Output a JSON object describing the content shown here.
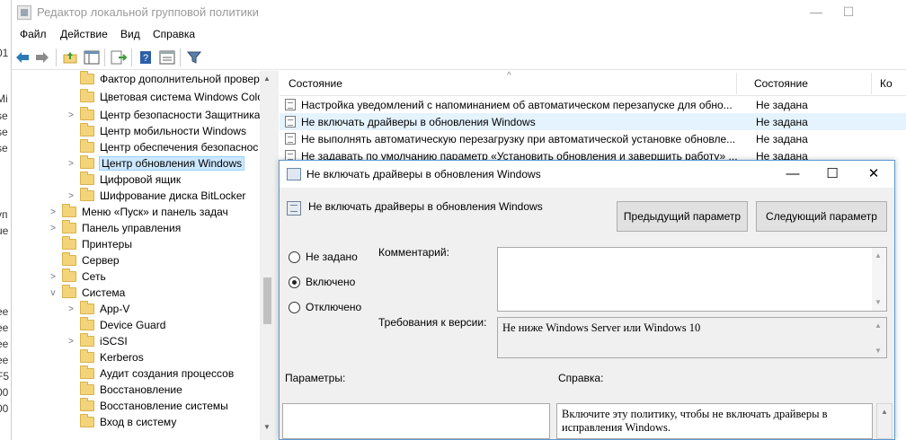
{
  "background_window": {
    "edge_chars": [
      "01",
      "Mi",
      "se",
      "se",
      "se",
      "уп",
      "ue",
      "ee",
      "ee",
      "ee",
      "ee",
      "F5",
      "00",
      "00"
    ]
  },
  "window": {
    "title": "Редактор локальной групповой политики",
    "controls": {
      "minimize": "—",
      "maximize": "☐"
    }
  },
  "menu": {
    "items": [
      "Файл",
      "Действие",
      "Вид",
      "Справка"
    ]
  },
  "toolbar": {
    "icons": [
      "back-arrow-icon",
      "forward-arrow-icon",
      "folder-up-icon",
      "show-hide-tree-icon",
      "export-list-icon",
      "help-icon",
      "extended-view-icon",
      "filter-icon"
    ]
  },
  "tree": {
    "items": [
      {
        "label": "Фактор дополнительной провер",
        "level": 2,
        "expander": ""
      },
      {
        "label": "Цветовая система Windows Colo",
        "level": 2,
        "expander": ""
      },
      {
        "label": "Центр безопасности Защитника",
        "level": 2,
        "expander": ">"
      },
      {
        "label": "Центр мобильности Windows",
        "level": 2,
        "expander": ""
      },
      {
        "label": "Центр обеспечения безопаснос",
        "level": 2,
        "expander": ""
      },
      {
        "label": "Центр обновления Windows",
        "level": 2,
        "expander": ">",
        "selected": true
      },
      {
        "label": "Цифровой ящик",
        "level": 2,
        "expander": ""
      },
      {
        "label": "Шифрование диска BitLocker",
        "level": 2,
        "expander": ">"
      },
      {
        "label": "Меню «Пуск» и панель задач",
        "level": 1,
        "expander": ">"
      },
      {
        "label": "Панель управления",
        "level": 1,
        "expander": ">"
      },
      {
        "label": "Принтеры",
        "level": 1,
        "expander": ""
      },
      {
        "label": "Сервер",
        "level": 1,
        "expander": ""
      },
      {
        "label": "Сеть",
        "level": 1,
        "expander": ">"
      },
      {
        "label": "Система",
        "level": 1,
        "expander": "v"
      },
      {
        "label": "App-V",
        "level": 2,
        "expander": ">"
      },
      {
        "label": "Device Guard",
        "level": 2,
        "expander": ""
      },
      {
        "label": "iSCSI",
        "level": 2,
        "expander": ">"
      },
      {
        "label": "Kerberos",
        "level": 2,
        "expander": ""
      },
      {
        "label": "Аудит создания процессов",
        "level": 2,
        "expander": ""
      },
      {
        "label": "Восстановление",
        "level": 2,
        "expander": ""
      },
      {
        "label": "Восстановление системы",
        "level": 2,
        "expander": ""
      },
      {
        "label": "Вход в систему",
        "level": 2,
        "expander": ""
      }
    ]
  },
  "list": {
    "columns": [
      "Состояние",
      "Состояние",
      "Ко"
    ],
    "rows": [
      {
        "name": "Настройка уведомлений с напоминанием об автоматическом перезапуске для обно...",
        "state": "Не задана"
      },
      {
        "name": "Не включать драйверы в обновления Windows",
        "state": "Не задана",
        "highlight": true
      },
      {
        "name": "Не выполнять автоматическую перезагрузку при автоматической установке обновле...",
        "state": "Не задана"
      },
      {
        "name": "Не задавать по умолчанию параметр «Установить обновления и завершить работу» ...",
        "state": "Не задана"
      }
    ]
  },
  "dialog": {
    "title": "Не включать драйверы в обновления Windows",
    "heading": "Не включать драйверы в обновления Windows",
    "prev_button": "Предыдущий параметр",
    "next_button": "Следующий параметр",
    "radios": [
      {
        "label": "Не задано",
        "checked": false
      },
      {
        "label": "Включено",
        "checked": true
      },
      {
        "label": "Отключено",
        "checked": false
      }
    ],
    "comment_label": "Комментарий:",
    "comment_value": "",
    "version_label": "Требования к версии:",
    "version_value": "Не ниже Windows Server или Windows 10",
    "params_label": "Параметры:",
    "help_label": "Справка:",
    "help_text_line1": "Включите эту политику, чтобы не включать драйверы в",
    "help_text_line2": "исправления Windows."
  }
}
